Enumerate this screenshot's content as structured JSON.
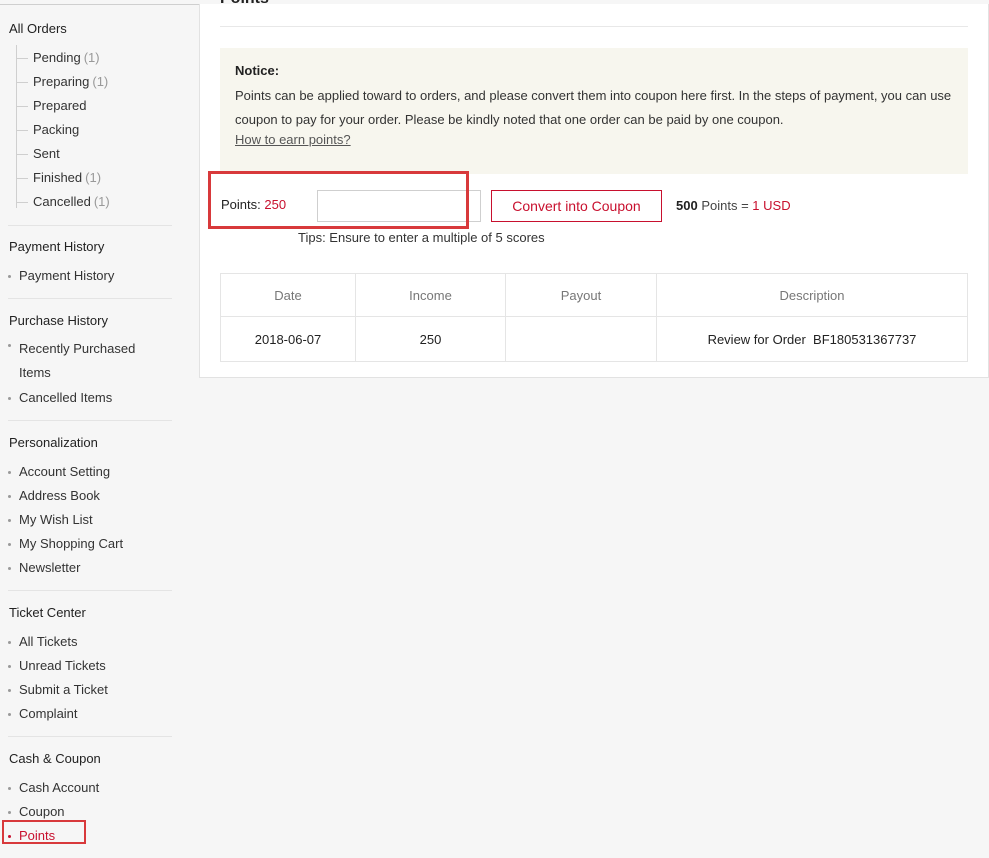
{
  "sidebar": {
    "all_orders": {
      "title": "All Orders",
      "items": [
        {
          "label": "Pending",
          "count": "(1)"
        },
        {
          "label": "Preparing",
          "count": "(1)"
        },
        {
          "label": "Prepared",
          "count": ""
        },
        {
          "label": "Packing",
          "count": ""
        },
        {
          "label": "Sent",
          "count": ""
        },
        {
          "label": "Finished",
          "count": "(1)"
        },
        {
          "label": "Cancelled",
          "count": "(1)"
        }
      ]
    },
    "payment_history": {
      "title": "Payment History",
      "items": [
        "Payment History"
      ]
    },
    "purchase_history": {
      "title": "Purchase History",
      "recently_line1": "Recently Purchased",
      "recently_line2": "Items",
      "cancelled": "Cancelled Items"
    },
    "personalization": {
      "title": "Personalization",
      "items": [
        "Account Setting",
        "Address Book",
        "My Wish List",
        "My Shopping Cart",
        "Newsletter"
      ]
    },
    "ticket_center": {
      "title": "Ticket Center",
      "items": [
        "All Tickets",
        "Unread Tickets",
        "Submit a Ticket",
        "Complaint"
      ]
    },
    "cash_coupon": {
      "title": "Cash & Coupon",
      "items": [
        "Cash Account",
        "Coupon",
        "Points"
      ]
    }
  },
  "main": {
    "title": "Points",
    "notice": {
      "heading": "Notice:",
      "body": "Points can be applied toward to orders, and please convert them into coupon here first. In the steps of payment, you can use coupon to pay for your order. Please be kindly noted that one order can be paid by one coupon.",
      "link": "How to earn points?"
    },
    "points_label": "Points:",
    "points_value": "250",
    "input_value": "",
    "convert_button": "Convert into Coupon",
    "rate_points": "500",
    "rate_text": "Points =",
    "rate_usd": "1 USD",
    "tips": "Tips: Ensure to enter a multiple of 5 scores",
    "table": {
      "headers": [
        "Date",
        "Income",
        "Payout",
        "Description"
      ],
      "rows": [
        [
          "2018-06-07",
          "250",
          "",
          "Review for Order  BF180531367737"
        ]
      ]
    }
  },
  "colors": {
    "accent": "#c8102e",
    "highlight_box": "#d8393b"
  }
}
